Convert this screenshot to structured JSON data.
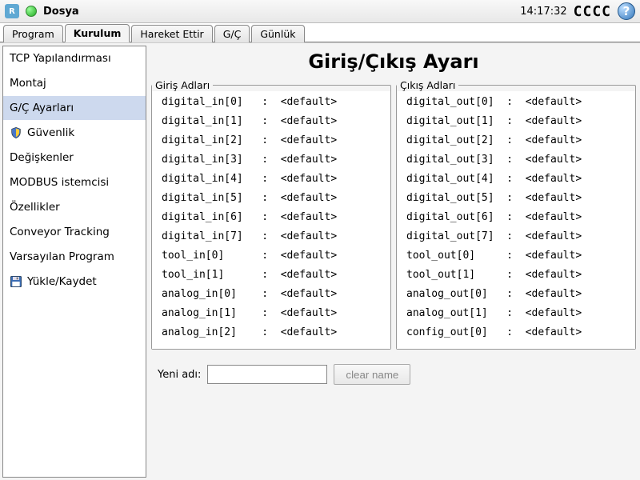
{
  "topbar": {
    "title": "Dosya",
    "clock": "14:17:32",
    "badge": "CCCC"
  },
  "tabs": [
    {
      "label": "Program",
      "active": false
    },
    {
      "label": "Kurulum",
      "active": true
    },
    {
      "label": "Hareket Ettir",
      "active": false
    },
    {
      "label": "G/Ç",
      "active": false
    },
    {
      "label": "Günlük",
      "active": false
    }
  ],
  "sidebar": [
    {
      "label": "TCP Yapılandırması",
      "icon": null,
      "selected": false
    },
    {
      "label": "Montaj",
      "icon": null,
      "selected": false
    },
    {
      "label": "G/Ç Ayarları",
      "icon": null,
      "selected": true
    },
    {
      "label": "Güvenlik",
      "icon": "shield",
      "selected": false
    },
    {
      "label": "Değişkenler",
      "icon": null,
      "selected": false
    },
    {
      "label": "MODBUS istemcisi",
      "icon": null,
      "selected": false
    },
    {
      "label": "Özellikler",
      "icon": null,
      "selected": false
    },
    {
      "label": "Conveyor Tracking",
      "icon": null,
      "selected": false
    },
    {
      "label": "Varsayılan Program",
      "icon": null,
      "selected": false
    },
    {
      "label": "Yükle/Kaydet",
      "icon": "disk",
      "selected": false
    }
  ],
  "main": {
    "title": "Giriş/Çıkış Ayarı",
    "inputs_legend": "Giriş Adları",
    "outputs_legend": "Çıkış Adları",
    "inputs": [
      {
        "name": "digital_in[0]",
        "value": "<default>"
      },
      {
        "name": "digital_in[1]",
        "value": "<default>"
      },
      {
        "name": "digital_in[2]",
        "value": "<default>"
      },
      {
        "name": "digital_in[3]",
        "value": "<default>"
      },
      {
        "name": "digital_in[4]",
        "value": "<default>"
      },
      {
        "name": "digital_in[5]",
        "value": "<default>"
      },
      {
        "name": "digital_in[6]",
        "value": "<default>"
      },
      {
        "name": "digital_in[7]",
        "value": "<default>"
      },
      {
        "name": "tool_in[0]",
        "value": "<default>"
      },
      {
        "name": "tool_in[1]",
        "value": "<default>"
      },
      {
        "name": "analog_in[0]",
        "value": "<default>"
      },
      {
        "name": "analog_in[1]",
        "value": "<default>"
      },
      {
        "name": "analog_in[2]",
        "value": "<default>"
      }
    ],
    "outputs": [
      {
        "name": "digital_out[0]",
        "value": "<default>"
      },
      {
        "name": "digital_out[1]",
        "value": "<default>"
      },
      {
        "name": "digital_out[2]",
        "value": "<default>"
      },
      {
        "name": "digital_out[3]",
        "value": "<default>"
      },
      {
        "name": "digital_out[4]",
        "value": "<default>"
      },
      {
        "name": "digital_out[5]",
        "value": "<default>"
      },
      {
        "name": "digital_out[6]",
        "value": "<default>"
      },
      {
        "name": "digital_out[7]",
        "value": "<default>"
      },
      {
        "name": "tool_out[0]",
        "value": "<default>"
      },
      {
        "name": "tool_out[1]",
        "value": "<default>"
      },
      {
        "name": "analog_out[0]",
        "value": "<default>"
      },
      {
        "name": "analog_out[1]",
        "value": "<default>"
      },
      {
        "name": "config_out[0]",
        "value": "<default>"
      }
    ],
    "rename_label": "Yeni adı:",
    "rename_value": "",
    "clear_label": "clear name"
  }
}
